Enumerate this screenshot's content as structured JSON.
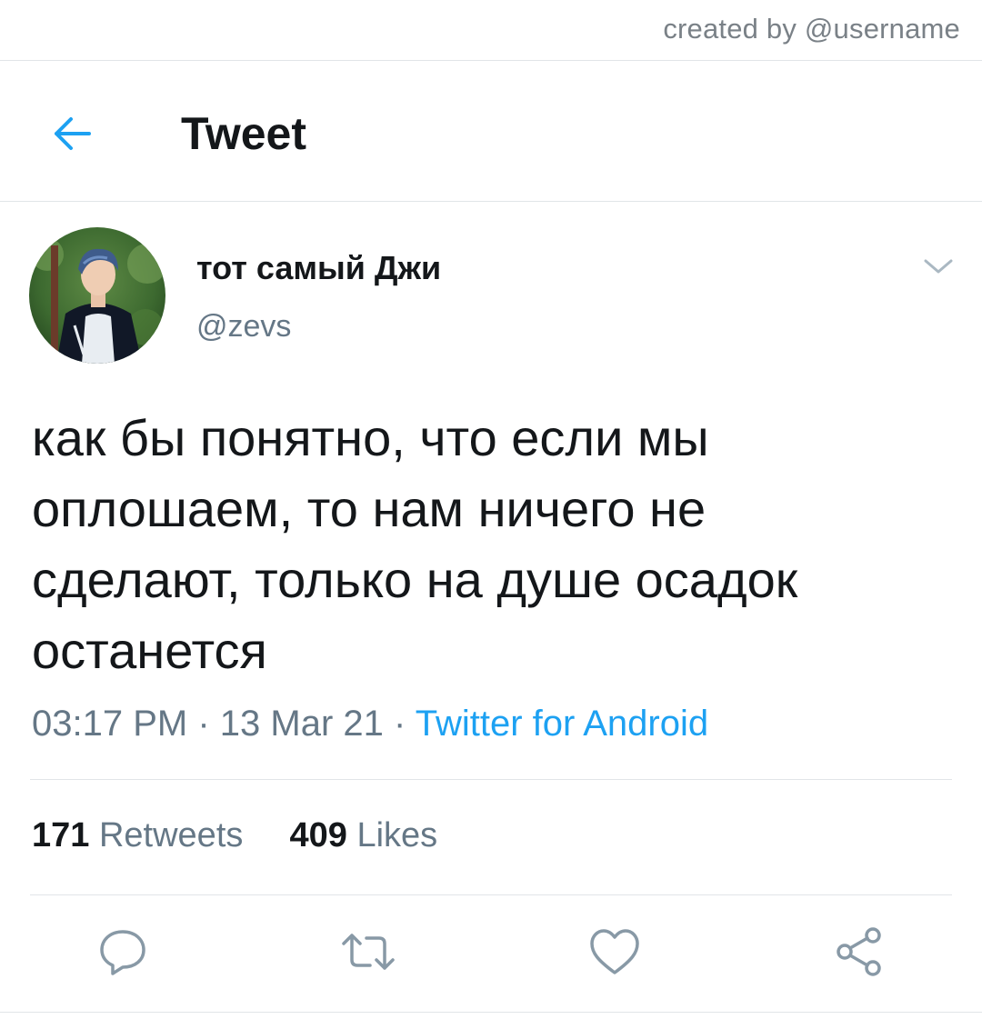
{
  "watermark": "created by @username",
  "header": {
    "title": "Tweet",
    "back_icon": "arrow-left-icon"
  },
  "tweet": {
    "display_name": "тот самый Джи",
    "handle": "@zevs",
    "text": "как бы понятно, что если мы\nоплошаем, то нам ничего не\nсделают, только на душе осадок\nостанется",
    "time": "03:17 PM",
    "date": "13 Mar 21",
    "separator": "·",
    "source": "Twitter for Android"
  },
  "stats": {
    "retweets_count": "171",
    "retweets_label": "Retweets",
    "likes_count": "409",
    "likes_label": "Likes"
  },
  "actions": [
    "reply-icon",
    "retweet-icon",
    "like-icon",
    "share-icon"
  ],
  "colors": {
    "accent": "#1da1f2",
    "text": "#14171a",
    "secondary": "#657786",
    "icon": "#8899a6",
    "divider": "#e1e5e8"
  }
}
